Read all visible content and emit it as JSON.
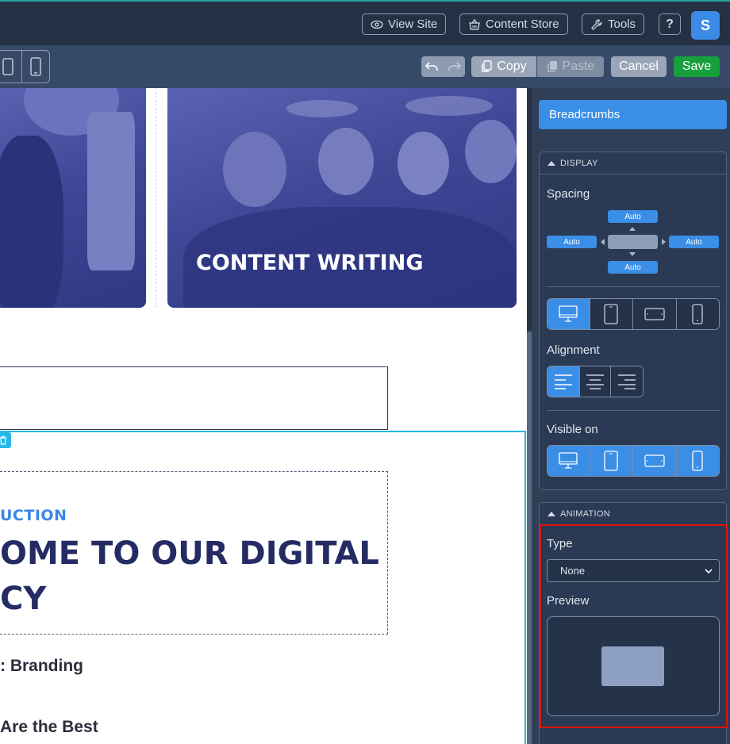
{
  "topbar": {
    "view_site": "View Site",
    "content_store": "Content Store",
    "tools": "Tools",
    "help": "?",
    "avatar_initial": "S"
  },
  "toolbar": {
    "copy": "Copy",
    "paste": "Paste",
    "cancel": "Cancel",
    "save": "Save"
  },
  "canvas": {
    "card_title": "CONTENT WRITING",
    "intro_label": "UCTION",
    "hero_line1": "OME TO OUR DIGITAL",
    "hero_line2": "CY",
    "sub1": ": Branding",
    "sub2": "Are the Best"
  },
  "panel": {
    "breadcrumbs": "Breadcrumbs",
    "display_header": "DISPLAY",
    "spacing_label": "Spacing",
    "spacing": {
      "top": "Auto",
      "left": "Auto",
      "right": "Auto",
      "bottom": "Auto"
    },
    "alignment_label": "Alignment",
    "visible_on_label": "Visible on",
    "animation_header": "ANIMATION",
    "type_label": "Type",
    "type_value": "None",
    "preview_label": "Preview"
  },
  "colors": {
    "topbar_bg": "#243044",
    "toolbar_bg": "#364a68",
    "accent": "#3a8ee6",
    "save": "#15a03c",
    "highlight": "#e01010",
    "hero_text": "#242c63",
    "intro_text": "#3a86e5"
  }
}
